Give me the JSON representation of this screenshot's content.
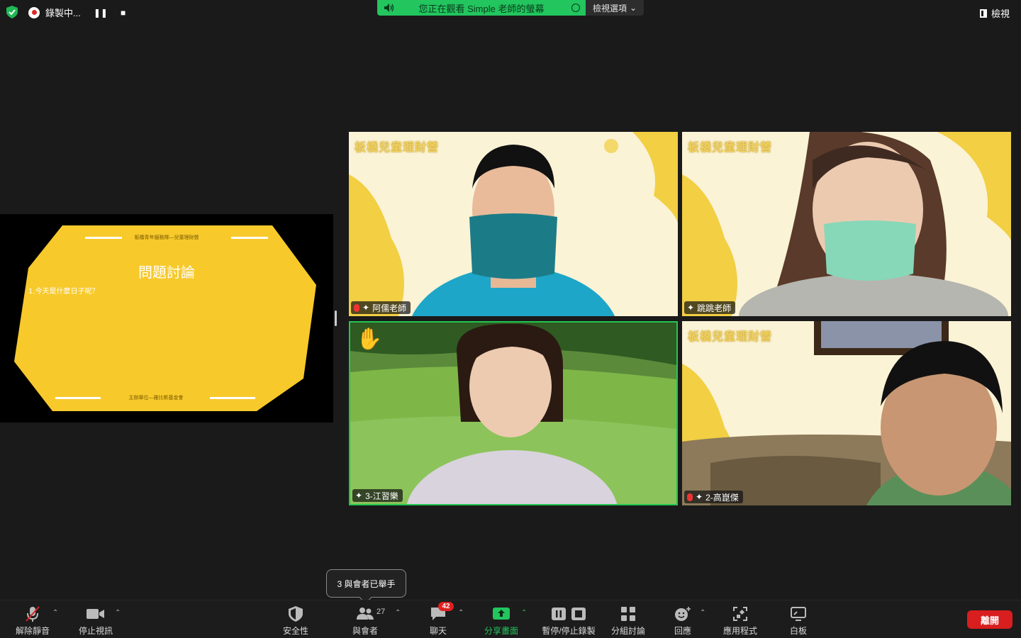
{
  "topbar": {
    "recording_label": "錄製中...",
    "pause_glyph": "❚❚",
    "stop_glyph": "■",
    "banner_text": "您正在觀看 Simple 老師的螢幕",
    "view_options_label": "檢視選項",
    "view_label": "檢視"
  },
  "shared_screen": {
    "header": "板橋青年服務隊—兒童理財營",
    "title": "問題討論",
    "question": "1.今天是什麼日子呢？",
    "footer": "主辦單位—雅比斯基金會"
  },
  "participants": [
    {
      "name": "阿儒老師",
      "muted": true,
      "brand": "板橋兒童理財營"
    },
    {
      "name": "跳跳老師",
      "muted": false,
      "brand": "板橋兒童理財營"
    },
    {
      "name": "3-江習樂",
      "muted": false,
      "hand_raised": true,
      "active_speaker": true
    },
    {
      "name": "2-高崑傑",
      "muted": true,
      "brand": "板橋兒童理財營"
    }
  ],
  "tooltip": {
    "text": "3 與會者已舉手"
  },
  "toolbar": {
    "unmute": "解除靜音",
    "stop_video": "停止視訊",
    "security": "安全性",
    "participants": "與會者",
    "participants_count": "27",
    "chat": "聊天",
    "chat_badge": "42",
    "share_screen": "分享畫面",
    "pause_stop_recording": "暫停/停止錄製",
    "breakout_rooms": "分組討論",
    "reactions": "回應",
    "apps": "應用程式",
    "whiteboard": "白板",
    "leave": "離開"
  },
  "colors": {
    "accent_green": "#22c55e",
    "active_border": "#23c552",
    "leave_red": "#d81e1e",
    "slide_yellow": "#f7c92b"
  }
}
